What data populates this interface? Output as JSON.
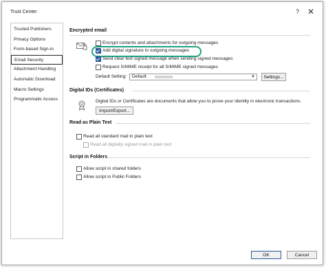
{
  "window": {
    "title": "Trust Center",
    "help": "?",
    "close": "✕"
  },
  "sidebar": {
    "items": [
      {
        "label": "Trusted Publishers"
      },
      {
        "label": "Privacy Options"
      },
      {
        "label": "Form-based Sign-in"
      },
      {
        "label": "Email Security"
      },
      {
        "label": "Attachment Handling"
      },
      {
        "label": "Automatic Download"
      },
      {
        "label": "Macro Settings"
      },
      {
        "label": "Programmatic Access"
      }
    ],
    "selected": "Email Security"
  },
  "encrypted_email": {
    "heading": "Encrypted email",
    "icon": "envelope-lock-icon",
    "options": [
      {
        "label": "Encrypt contents and attachments for outgoing messages",
        "checked": false
      },
      {
        "label": "Add digital signature to outgoing messages",
        "checked": true
      },
      {
        "label": "Send clear text signed message when sending signed messages",
        "checked": true
      },
      {
        "label": "Request S/MIME receipt for all S/MIME signed messages",
        "checked": false
      }
    ],
    "default_setting_label": "Default Setting:",
    "default_setting_value": "Default",
    "settings_button": "Settings..."
  },
  "digital_ids": {
    "heading": "Digital IDs (Certificates)",
    "icon": "certificate-icon",
    "description": "Digital IDs or Certificates are documents that allow you to prove your identity in electronic transactions.",
    "import_export_button": "Import/Export..."
  },
  "plain_text": {
    "heading": "Read as Plain Text",
    "options": [
      {
        "label": "Read all standard mail in plain text",
        "checked": false,
        "enabled": true
      },
      {
        "label": "Read all digitally signed mail in plain text",
        "checked": false,
        "enabled": false
      }
    ]
  },
  "script_folders": {
    "heading": "Script in Folders",
    "options": [
      {
        "label": "Allow script in shared folders",
        "checked": false
      },
      {
        "label": "Allow script in Public Folders",
        "checked": false
      }
    ]
  },
  "footer": {
    "ok": "OK",
    "cancel": "Cancel"
  },
  "colors": {
    "highlight": "#1aa281",
    "checkbox_on": "#2a5699"
  }
}
